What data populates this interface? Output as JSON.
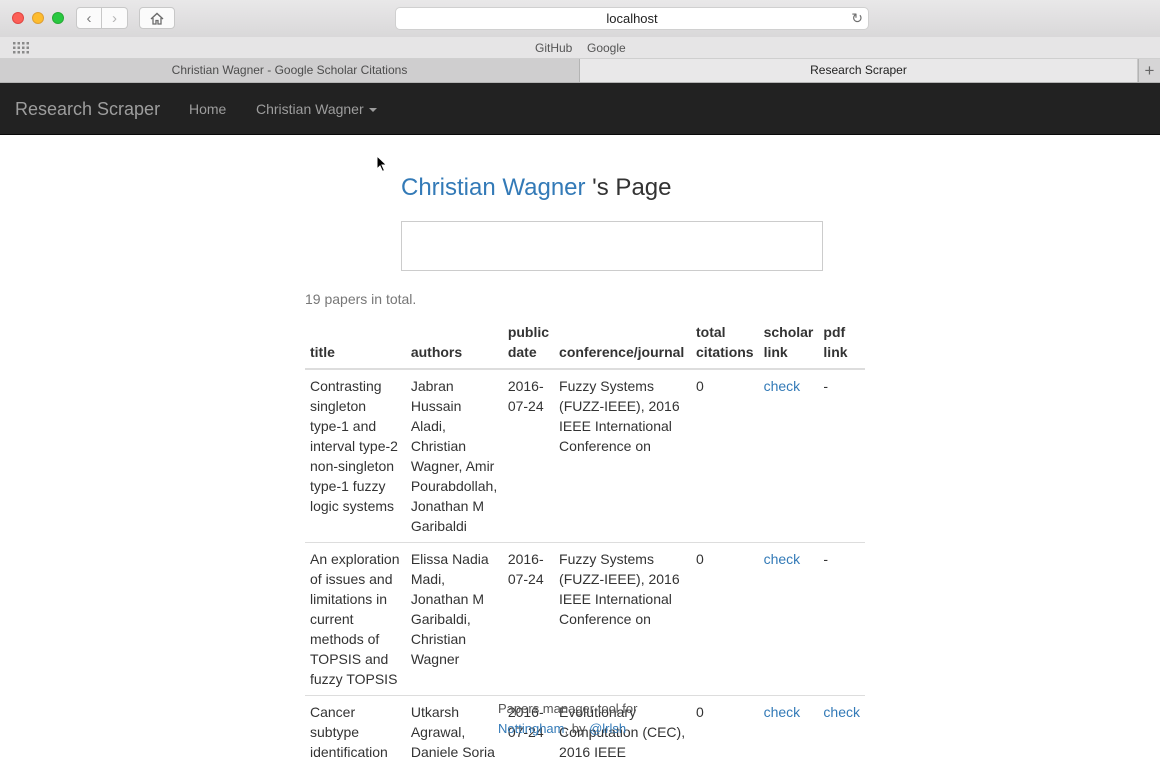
{
  "browser": {
    "url": "localhost",
    "favorites": [
      "GitHub",
      "Google"
    ],
    "tabs": [
      {
        "label": "Christian Wagner - Google Scholar Citations",
        "active": false
      },
      {
        "label": "Research Scraper",
        "active": true
      }
    ],
    "new_tab_label": "+"
  },
  "navbar": {
    "brand": "Research Scraper",
    "home": "Home",
    "dropdown": "Christian Wagner"
  },
  "page": {
    "author_name": "Christian Wagner",
    "title_suffix": " 's Page",
    "paper_count_text": "19 papers in total."
  },
  "table": {
    "headers": [
      "title",
      "authors",
      "public date",
      "conference/journal",
      "total citations",
      "scholar link",
      "pdf link"
    ],
    "rows": [
      {
        "title": "Contrasting singleton type-1 and interval type-2 non-singleton type-1 fuzzy logic systems",
        "authors": "Jabran Hussain Aladi, Christian Wagner, Amir Pourabdollah, Jonathan M Garibaldi",
        "date": "2016-07-24",
        "venue": "Fuzzy Systems (FUZZ-IEEE), 2016 IEEE International Conference on",
        "citations": "0",
        "scholar": "check",
        "pdf": "-"
      },
      {
        "title": "An exploration of issues and limitations in current methods of TOPSIS and fuzzy TOPSIS",
        "authors": "Elissa Nadia Madi, Jonathan M Garibaldi, Christian Wagner",
        "date": "2016-07-24",
        "venue": "Fuzzy Systems (FUZZ-IEEE), 2016 IEEE International Conference on",
        "citations": "0",
        "scholar": "check",
        "pdf": "-"
      },
      {
        "title": "Cancer subtype identification",
        "authors": "Utkarsh Agrawal, Daniele Soria",
        "date": "2016-07-24",
        "venue": "Evolutionary Computation (CEC), 2016 IEEE",
        "citations": "0",
        "scholar": "check",
        "pdf": "check"
      }
    ]
  },
  "footer": {
    "text": "Papers manager tool for",
    "link_1": "Nottingham",
    "sep": ", by ",
    "link_2": "@lrlsh"
  }
}
